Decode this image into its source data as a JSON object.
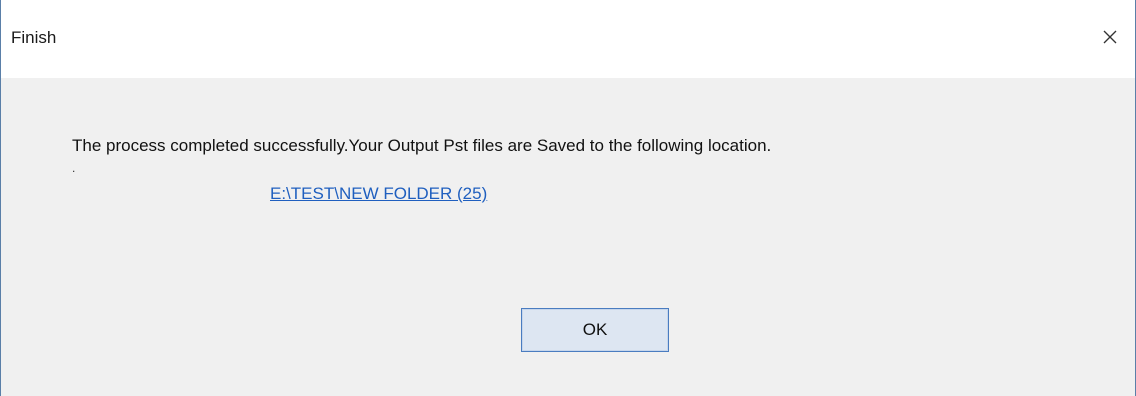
{
  "dialog": {
    "title": "Finish",
    "close_icon": "close-icon",
    "message": "The process  completed successfully.Your Output Pst files are Saved to the following location.",
    "stray_mark": ".",
    "location_link": "E:\\TEST\\NEW FOLDER (25)",
    "ok_label": "OK"
  },
  "colors": {
    "titlebar_bg": "#ffffff",
    "body_bg": "#f0f0f0",
    "link": "#1f5fbf",
    "button_bg": "#dde6f2",
    "button_border": "#4a7cc0",
    "window_border": "#5a7fa8"
  }
}
